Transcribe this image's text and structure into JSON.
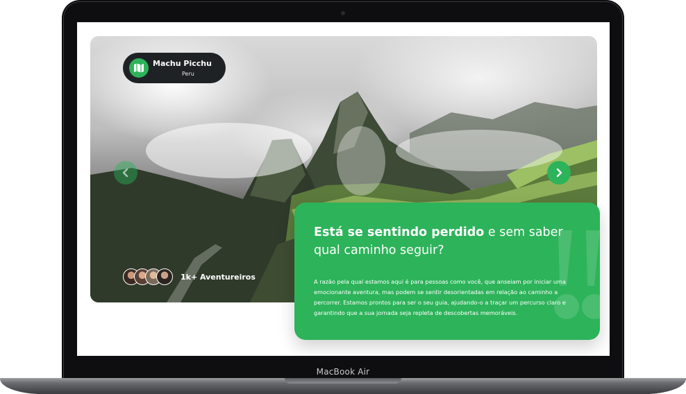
{
  "device": {
    "label": "MacBook Air"
  },
  "hero": {
    "location_name": "Machu Picchu",
    "location_country": "Peru",
    "adventurers_label": "1k+ Aventureiros"
  },
  "card": {
    "headline_bold": "Está se sentindo perdido",
    "headline_rest": " e sem saber qual caminho seguir?",
    "body": "A razão pela qual estamos aqui é para pessoas como você, que anseiam por iniciar uma emocionante aventura, mas podem se sentir desorientadas em relação ao caminho a percorrer. Estamos prontos para ser o seu guia, ajudando-o a traçar um percurso claro e garantindo que a sua jornada seja repleta de descobertas memoráveis."
  },
  "colors": {
    "accent": "#2db35a",
    "pill": "#1f2225",
    "frame": "#0e0e10"
  },
  "icons": {
    "location": "map-icon",
    "prev": "chevron-left-icon",
    "next": "chevron-right-icon"
  }
}
